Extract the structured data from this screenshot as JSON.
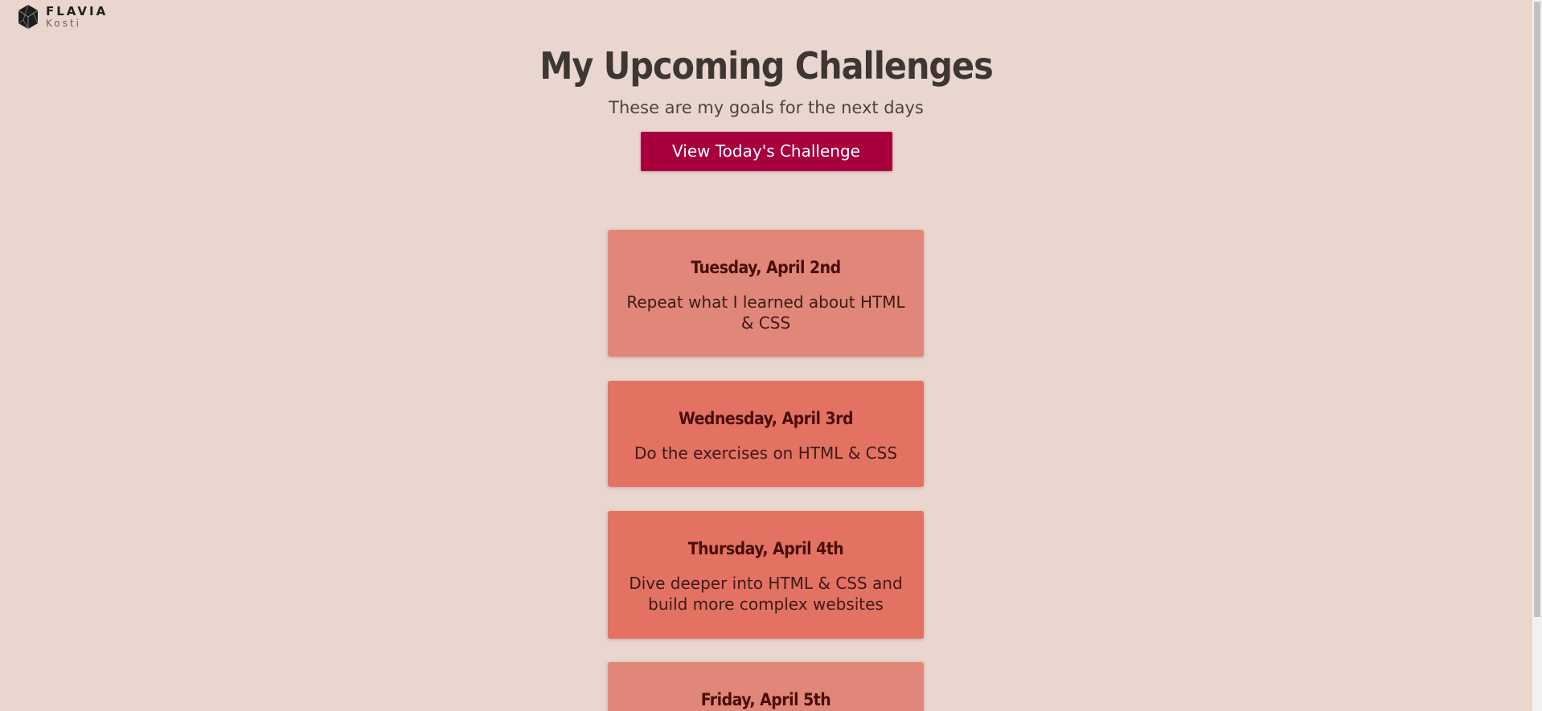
{
  "logo": {
    "name": "FLAVIA",
    "sub": "Kosti",
    "icon": "geometric-gem-icon"
  },
  "header": {
    "title": "My Upcoming Challenges",
    "subtitle": "These are my goals for the next days",
    "button_label": "View Today's Challenge"
  },
  "challenges": [
    {
      "date": "Tuesday, April 2nd",
      "text": "Repeat what I learned about HTML & CSS"
    },
    {
      "date": "Wednesday, April 3rd",
      "text": "Do the exercises on HTML & CSS"
    },
    {
      "date": "Thursday, April 4th",
      "text": "Dive deeper into HTML & CSS and build more complex websites"
    },
    {
      "date": "Friday, April 5th",
      "text": ""
    }
  ],
  "colors": {
    "background": "#e9d6cf",
    "button": "#a7003d",
    "card_light": "#e0877a",
    "card_dark": "#e37263",
    "date_text": "#4a0e08"
  }
}
